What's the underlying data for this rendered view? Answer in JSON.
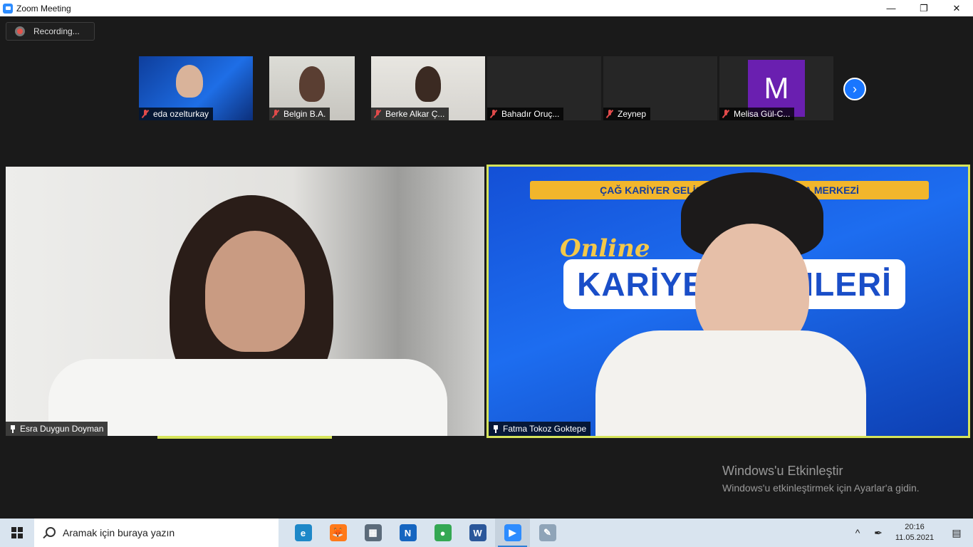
{
  "window": {
    "title": "Zoom Meeting",
    "controls": [
      "—",
      "❐",
      "✕"
    ]
  },
  "recording": {
    "label": "Recording..."
  },
  "thumbnails": [
    {
      "name": "eda ozelturkay",
      "muted": true
    },
    {
      "name": "Belgin B.A.",
      "muted": true
    },
    {
      "name": "Berke Alkar Ç...",
      "muted": true
    },
    {
      "name": "Bahadır Oruç...",
      "muted": true
    },
    {
      "name": "Zeynep",
      "muted": true
    },
    {
      "name": "Melisa Gül-C...",
      "muted": true,
      "avatar_letter": "M"
    }
  ],
  "next_page": {
    "icon": "chevron-right-icon",
    "glyph": "›"
  },
  "main_tiles": [
    {
      "name": "Esra Duygun Doyman",
      "pinned": true
    },
    {
      "name": "Fatma Tokoz Goktepe",
      "pinned": true,
      "active_speaker": true,
      "background": {
        "banner": "ÇAĞ KARİYER GELİŞTİRME VE ARAŞTIRMA MERKEZİ",
        "logo_top": "Online",
        "logo_main": "KARİYER GÜNLERİ"
      }
    }
  ],
  "activation_watermark": {
    "title": "Windows'u Etkinleştir",
    "subtitle": "Windows'u etkinleştirmek için Ayarlar'a gidin."
  },
  "taskbar": {
    "search_placeholder": "Aramak için buraya yazın",
    "apps": [
      {
        "name": "edge",
        "glyph": "e",
        "color": "#1e88c8"
      },
      {
        "name": "firefox",
        "glyph": "🦊",
        "color": "#ff7a1a"
      },
      {
        "name": "calculator",
        "glyph": "▦",
        "color": "#5c6b7a"
      },
      {
        "name": "nx",
        "glyph": "N",
        "color": "#1565c0"
      },
      {
        "name": "chrome",
        "glyph": "●",
        "color": "#34a853"
      },
      {
        "name": "word",
        "glyph": "W",
        "color": "#2b579a"
      },
      {
        "name": "zoom",
        "glyph": "▶",
        "color": "#2d8cff"
      },
      {
        "name": "paint",
        "glyph": "✎",
        "color": "#8fa4b8"
      }
    ],
    "tray": {
      "chevron": "^",
      "pen": "✒",
      "time": "20:16",
      "date": "11.05.2021",
      "notification": "▤"
    }
  },
  "colors": {
    "speaker_highlight": "#d6e45a",
    "stage_bg": "#1a1a1a",
    "taskbar_bg": "#d9e4ef"
  }
}
